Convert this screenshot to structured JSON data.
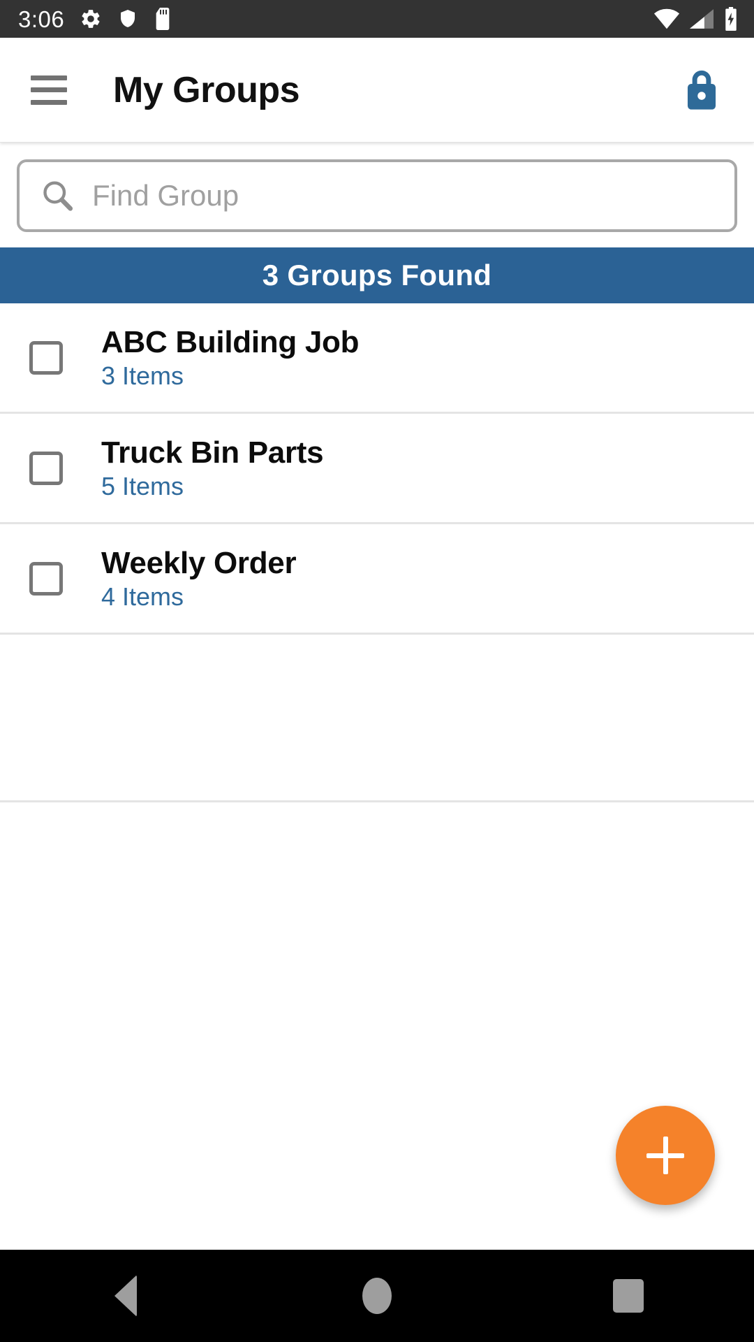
{
  "status_bar": {
    "clock": "3:06",
    "left_icons": [
      "gear-icon",
      "shield-icon",
      "sd-card-icon"
    ],
    "right_icons": [
      "wifi-icon",
      "cellular-signal-icon",
      "battery-charging-icon"
    ],
    "background_color": "#333333"
  },
  "app_bar": {
    "menu_icon": "hamburger-menu-icon",
    "title": "My Groups",
    "action_icon": "lock-icon",
    "lock_color": "#2E6A98"
  },
  "search": {
    "icon": "search-icon",
    "value": "",
    "placeholder": "Find Group"
  },
  "banner": {
    "text": "3 Groups Found",
    "background_color": "#2b6295",
    "text_color": "#ffffff"
  },
  "groups": [
    {
      "name": "ABC Building Job",
      "items_label": "3 Items",
      "checked": false
    },
    {
      "name": "Truck Bin Parts",
      "items_label": "5 Items",
      "checked": false
    },
    {
      "name": "Weekly Order",
      "items_label": "4 Items",
      "checked": false
    }
  ],
  "fab": {
    "icon": "plus-icon",
    "color": "#f5822a"
  },
  "nav_bar": {
    "back": "back-triangle-icon",
    "home": "home-circle-icon",
    "recents": "recents-square-icon"
  }
}
